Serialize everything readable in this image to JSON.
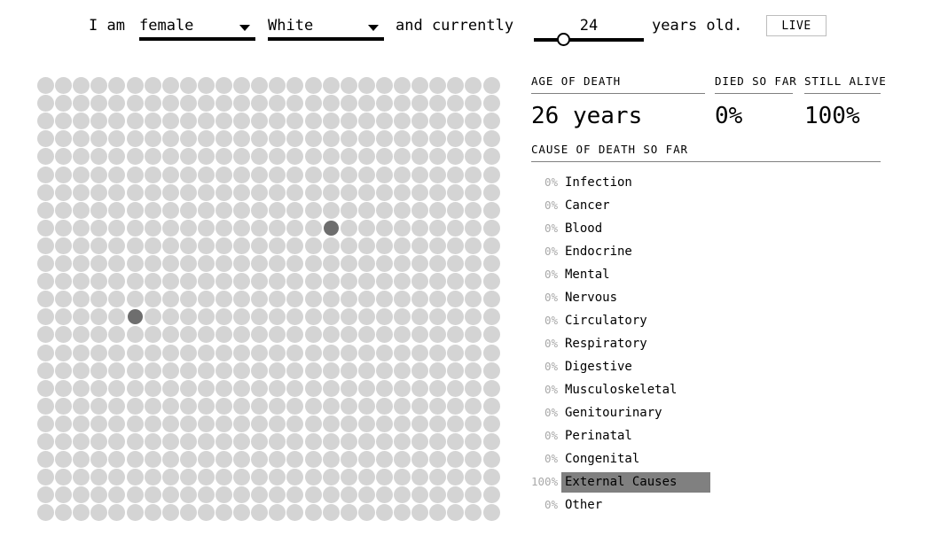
{
  "sentence": {
    "lead": "I am",
    "sex": {
      "value": "female",
      "arrow_icon": "chevron-down-icon"
    },
    "race": {
      "value": "White",
      "arrow_icon": "chevron-down-icon"
    },
    "middle": "and currently",
    "age": {
      "value": "24",
      "min": 0,
      "max": 100,
      "percent": 24
    },
    "trailing": "years old.",
    "live_label": "LIVE"
  },
  "grid": {
    "columns": 26,
    "rows": 25,
    "total_dots": 650,
    "alive_color": "#d4d4d4",
    "dead_color": "#6e6e6e",
    "dead_cells": [
      {
        "col": 16,
        "row": 8
      },
      {
        "col": 5,
        "row": 13
      }
    ]
  },
  "stats": [
    {
      "key": "age_of_death",
      "label": "AGE OF DEATH",
      "value": "26 years"
    },
    {
      "key": "died_so_far",
      "label": "DIED SO FAR",
      "value": "0%"
    },
    {
      "key": "still_alive",
      "label": "STILL ALIVE",
      "value": "100%"
    }
  ],
  "cause_section": {
    "header": "CAUSE OF DEATH SO FAR",
    "highlight_color": "#808080",
    "rows": [
      {
        "pct": "0%",
        "value": 0,
        "name": "Infection"
      },
      {
        "pct": "0%",
        "value": 0,
        "name": "Cancer"
      },
      {
        "pct": "0%",
        "value": 0,
        "name": "Blood"
      },
      {
        "pct": "0%",
        "value": 0,
        "name": "Endocrine"
      },
      {
        "pct": "0%",
        "value": 0,
        "name": "Mental"
      },
      {
        "pct": "0%",
        "value": 0,
        "name": "Nervous"
      },
      {
        "pct": "0%",
        "value": 0,
        "name": "Circulatory"
      },
      {
        "pct": "0%",
        "value": 0,
        "name": "Respiratory"
      },
      {
        "pct": "0%",
        "value": 0,
        "name": "Digestive"
      },
      {
        "pct": "0%",
        "value": 0,
        "name": "Musculoskeletal"
      },
      {
        "pct": "0%",
        "value": 0,
        "name": "Genitourinary"
      },
      {
        "pct": "0%",
        "value": 0,
        "name": "Perinatal"
      },
      {
        "pct": "0%",
        "value": 0,
        "name": "Congenital"
      },
      {
        "pct": "100%",
        "value": 100,
        "name": "External Causes"
      },
      {
        "pct": "0%",
        "value": 0,
        "name": "Other"
      }
    ]
  }
}
